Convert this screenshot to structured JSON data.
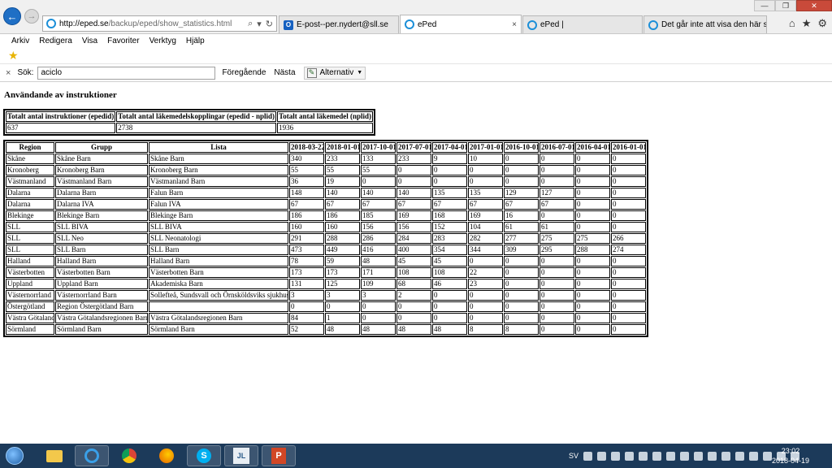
{
  "browser": {
    "url_host": "http://eped.se",
    "url_path": "/backup/eped/show_statistics.html",
    "addr_search_icon": "search-icon",
    "addr_refresh_icon": "refresh-icon",
    "tabs": [
      {
        "label": "E-post--per.nydert@sll.se",
        "icon": "outlook-icon"
      },
      {
        "label": "ePed",
        "icon": "ie-icon",
        "close": "×",
        "active": true
      },
      {
        "label": "ePed |",
        "icon": "ie-icon"
      },
      {
        "label": "Det går inte att visa den här sid...",
        "icon": "ie-icon"
      }
    ],
    "window_controls": {
      "minimize": "—",
      "maximize": "❐",
      "close": "✕"
    },
    "right_icons": {
      "home": "⌂",
      "favorites": "★",
      "settings": "⚙"
    }
  },
  "menu": [
    "Arkiv",
    "Redigera",
    "Visa",
    "Favoriter",
    "Verktyg",
    "Hjälp"
  ],
  "findbar": {
    "close": "×",
    "label": "Sök:",
    "value": "aciclo",
    "prev": "Föregående",
    "next": "Nästa",
    "options": "Alternativ"
  },
  "page": {
    "title": "Användande av instruktioner",
    "totals": {
      "headers": [
        "Totalt antal instruktioner (epedid)",
        "Totalt antal läkemedelskopplingar (epedid - nplid)",
        "Totalt antal läkemedel (nplid)"
      ],
      "values": [
        "637",
        "2738",
        "1936"
      ]
    },
    "stats": {
      "headers": [
        "Region",
        "Grupp",
        "Lista",
        "2018-03-22",
        "2018-01-01",
        "2017-10-01",
        "2017-07-01",
        "2017-04-01",
        "2017-01-01",
        "2016-10-01",
        "2016-07-01",
        "2016-04-01",
        "2016-01-01"
      ],
      "rows": [
        [
          "Skåne",
          "Skåne Barn",
          "Skåne Barn",
          "340",
          "233",
          "133",
          "233",
          "9",
          "10",
          "0",
          "0",
          "0",
          "0"
        ],
        [
          "Kronoberg",
          "Kronoberg Barn",
          "Kronoberg Barn",
          "55",
          "55",
          "55",
          "0",
          "0",
          "0",
          "0",
          "0",
          "0",
          "0"
        ],
        [
          "Västmanland",
          "Västmanland Barn",
          "Västmanland Barn",
          "36",
          "19",
          "0",
          "0",
          "0",
          "0",
          "0",
          "0",
          "0",
          "0"
        ],
        [
          "Dalarna",
          "Dalarna Barn",
          "Falun Barn",
          "148",
          "140",
          "140",
          "140",
          "135",
          "135",
          "129",
          "127",
          "0",
          "0"
        ],
        [
          "Dalarna",
          "Dalarna IVA",
          "Falun IVA",
          "67",
          "67",
          "67",
          "67",
          "67",
          "67",
          "67",
          "67",
          "0",
          "0"
        ],
        [
          "Blekinge",
          "Blekinge Barn",
          "Blekinge Barn",
          "186",
          "186",
          "185",
          "169",
          "168",
          "169",
          "16",
          "0",
          "0",
          "0"
        ],
        [
          "SLL",
          "SLL BIVA",
          "SLL BIVA",
          "160",
          "160",
          "156",
          "156",
          "152",
          "104",
          "61",
          "61",
          "0",
          "0"
        ],
        [
          "SLL",
          "SLL Neo",
          "SLL Neonatologi",
          "291",
          "288",
          "286",
          "284",
          "283",
          "282",
          "277",
          "275",
          "275",
          "266"
        ],
        [
          "SLL",
          "SLL Barn",
          "SLL Barn",
          "473",
          "449",
          "416",
          "400",
          "354",
          "344",
          "309",
          "295",
          "288",
          "274"
        ],
        [
          "Halland",
          "Halland Barn",
          "Halland Barn",
          "78",
          "59",
          "48",
          "45",
          "45",
          "0",
          "0",
          "0",
          "0",
          "0"
        ],
        [
          "Västerbotten",
          "Västerbotten Barn",
          "Västerbotten Barn",
          "173",
          "173",
          "171",
          "108",
          "108",
          "22",
          "0",
          "0",
          "0",
          "0"
        ],
        [
          "Uppland",
          "Uppland Barn",
          "Akademiska Barn",
          "131",
          "125",
          "109",
          "68",
          "46",
          "23",
          "0",
          "0",
          "0",
          "0"
        ],
        [
          "Västernorrland",
          "Västernorrland Barn",
          "Sollefteå, Sundsvall och Örnsköldsviks sjukhus",
          "3",
          "3",
          "3",
          "2",
          "0",
          "0",
          "0",
          "0",
          "0",
          "0"
        ],
        [
          "Östergötland",
          "Region Östergötland Barn",
          "",
          "0",
          "0",
          "0",
          "0",
          "0",
          "0",
          "0",
          "0",
          "0",
          "0"
        ],
        [
          "Västra Götaland",
          "Västra Götalandsregionen Barn",
          "Västra Götalandsregionen Barn",
          "84",
          "1",
          "0",
          "0",
          "0",
          "0",
          "0",
          "0",
          "0",
          "0"
        ],
        [
          "Sörmland",
          "Sörmland Barn",
          "Sörmland Barn",
          "52",
          "48",
          "48",
          "48",
          "48",
          "8",
          "8",
          "0",
          "0",
          "0"
        ]
      ]
    }
  },
  "taskbar": {
    "apps": [
      "file-explorer-icon",
      "internet-explorer-icon",
      "chrome-icon",
      "firefox-icon",
      "skype-icon",
      "nav-app-icon",
      "powerpoint-icon"
    ],
    "language": "SV",
    "time": "23:02",
    "date": "2018-04-19"
  }
}
